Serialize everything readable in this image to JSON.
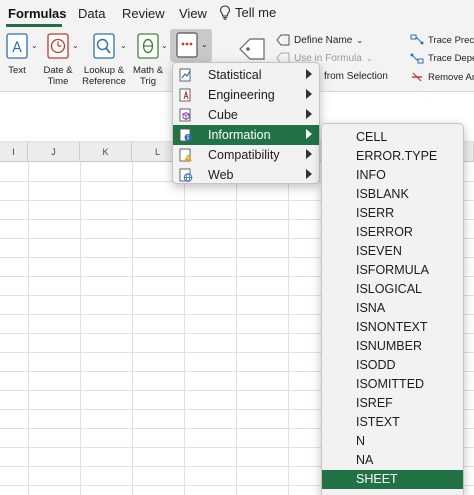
{
  "tabs": [
    {
      "label": "Formulas",
      "active": true
    },
    {
      "label": "Data",
      "active": false
    },
    {
      "label": "Review",
      "active": false
    },
    {
      "label": "View",
      "active": false
    }
  ],
  "tell_me": {
    "label": "Tell me",
    "icon": "lightbulb-icon"
  },
  "ribbon": {
    "buttons": [
      {
        "label": "Text",
        "icon": "text-function-icon"
      },
      {
        "label": "Date &\nTime",
        "icon": "date-time-function-icon"
      },
      {
        "label": "Lookup &\nReference",
        "icon": "lookup-reference-function-icon"
      },
      {
        "label": "Math &\nTrig",
        "icon": "math-trig-function-icon"
      },
      {
        "label": "",
        "icon": "more-functions-icon"
      }
    ],
    "define_name": "Define Name",
    "use_in_formula": "Use in Formula",
    "from_selection": "from Selection",
    "trace_precedents": "Trace Prec",
    "trace_dependents": "Trace Depe",
    "remove_arrows": "Remove Ar"
  },
  "columns": [
    "I",
    "J",
    "K",
    "L"
  ],
  "more_functions_menu": {
    "items": [
      {
        "label": "Statistical",
        "icon": "statistical-icon",
        "has_submenu": true
      },
      {
        "label": "Engineering",
        "icon": "engineering-icon",
        "has_submenu": true
      },
      {
        "label": "Cube",
        "icon": "cube-icon",
        "has_submenu": true
      },
      {
        "label": "Information",
        "icon": "information-icon",
        "has_submenu": true,
        "selected": true
      },
      {
        "label": "Compatibility",
        "icon": "compatibility-icon",
        "has_submenu": true
      },
      {
        "label": "Web",
        "icon": "web-icon",
        "has_submenu": true
      }
    ]
  },
  "information_submenu": {
    "items": [
      "CELL",
      "ERROR.TYPE",
      "INFO",
      "ISBLANK",
      "ISERR",
      "ISERROR",
      "ISEVEN",
      "ISFORMULA",
      "ISLOGICAL",
      "ISNA",
      "ISNONTEXT",
      "ISNUMBER",
      "ISODD",
      "ISOMITTED",
      "ISREF",
      "ISTEXT",
      "N",
      "NA",
      "SHEET"
    ],
    "selected": "SHEET"
  },
  "colors": {
    "accent": "#217346",
    "underline": "#1e7145",
    "ribbon_bg": "#f3f3f3"
  }
}
